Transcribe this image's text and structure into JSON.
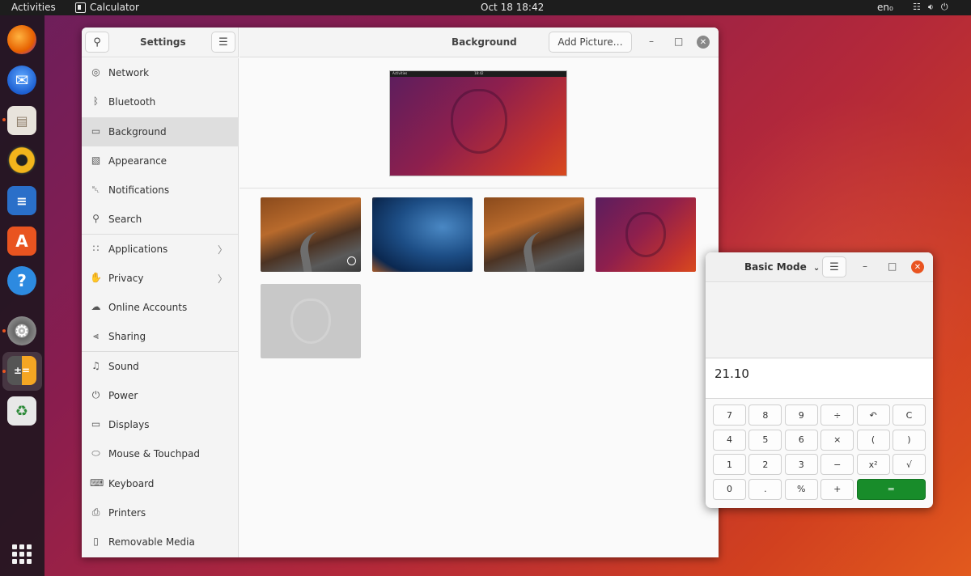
{
  "topbar": {
    "activities": "Activities",
    "app_name": "Calculator",
    "clock": "Oct 18  18:42",
    "lang": "en₀",
    "tray_icons": [
      "network-icon",
      "volume-icon",
      "power-icon"
    ]
  },
  "dock": {
    "apps": [
      "firefox",
      "thunderbird",
      "files",
      "rhythmbox",
      "libreoffice-writer",
      "app-center",
      "help",
      "settings",
      "calculator",
      "trash"
    ]
  },
  "settings": {
    "title": "Settings",
    "page_title": "Background",
    "add_picture": "Add Picture…",
    "sidebar": [
      {
        "label": "Network",
        "icon": "network-icon"
      },
      {
        "label": "Bluetooth",
        "icon": "bluetooth-icon"
      },
      {
        "label": "Background",
        "icon": "display-icon",
        "selected": true
      },
      {
        "label": "Appearance",
        "icon": "appearance-icon"
      },
      {
        "label": "Notifications",
        "icon": "bell-icon"
      },
      {
        "label": "Search",
        "icon": "search-icon"
      },
      {
        "label": "Applications",
        "icon": "apps-icon",
        "chevron": true
      },
      {
        "label": "Privacy",
        "icon": "hand-icon",
        "chevron": true
      },
      {
        "label": "Online Accounts",
        "icon": "cloud-icon"
      },
      {
        "label": "Sharing",
        "icon": "share-icon"
      },
      {
        "label": "Sound",
        "icon": "music-note-icon"
      },
      {
        "label": "Power",
        "icon": "power-icon"
      },
      {
        "label": "Displays",
        "icon": "monitor-icon"
      },
      {
        "label": "Mouse & Touchpad",
        "icon": "mouse-icon"
      },
      {
        "label": "Keyboard",
        "icon": "keyboard-icon"
      },
      {
        "label": "Printers",
        "icon": "printer-icon"
      },
      {
        "label": "Removable Media",
        "icon": "usb-icon"
      }
    ],
    "preview": {
      "bar_left": "Activities",
      "bar_center": "18:42"
    },
    "wallpapers": [
      {
        "type": "forest",
        "selected": true
      },
      {
        "type": "sky"
      },
      {
        "type": "forest"
      },
      {
        "type": "ubuntu"
      },
      {
        "type": "grey"
      }
    ]
  },
  "calculator": {
    "mode": "Basic Mode",
    "display": "21.10",
    "keys": [
      [
        "7",
        "8",
        "9",
        "÷",
        "↶",
        "C"
      ],
      [
        "4",
        "5",
        "6",
        "×",
        "(",
        ")"
      ],
      [
        "1",
        "2",
        "3",
        "−",
        "x²",
        "√"
      ],
      [
        "0",
        ".",
        "%",
        "+",
        "="
      ]
    ],
    "equals_color": "#188c2a",
    "close_color": "#e95420"
  }
}
